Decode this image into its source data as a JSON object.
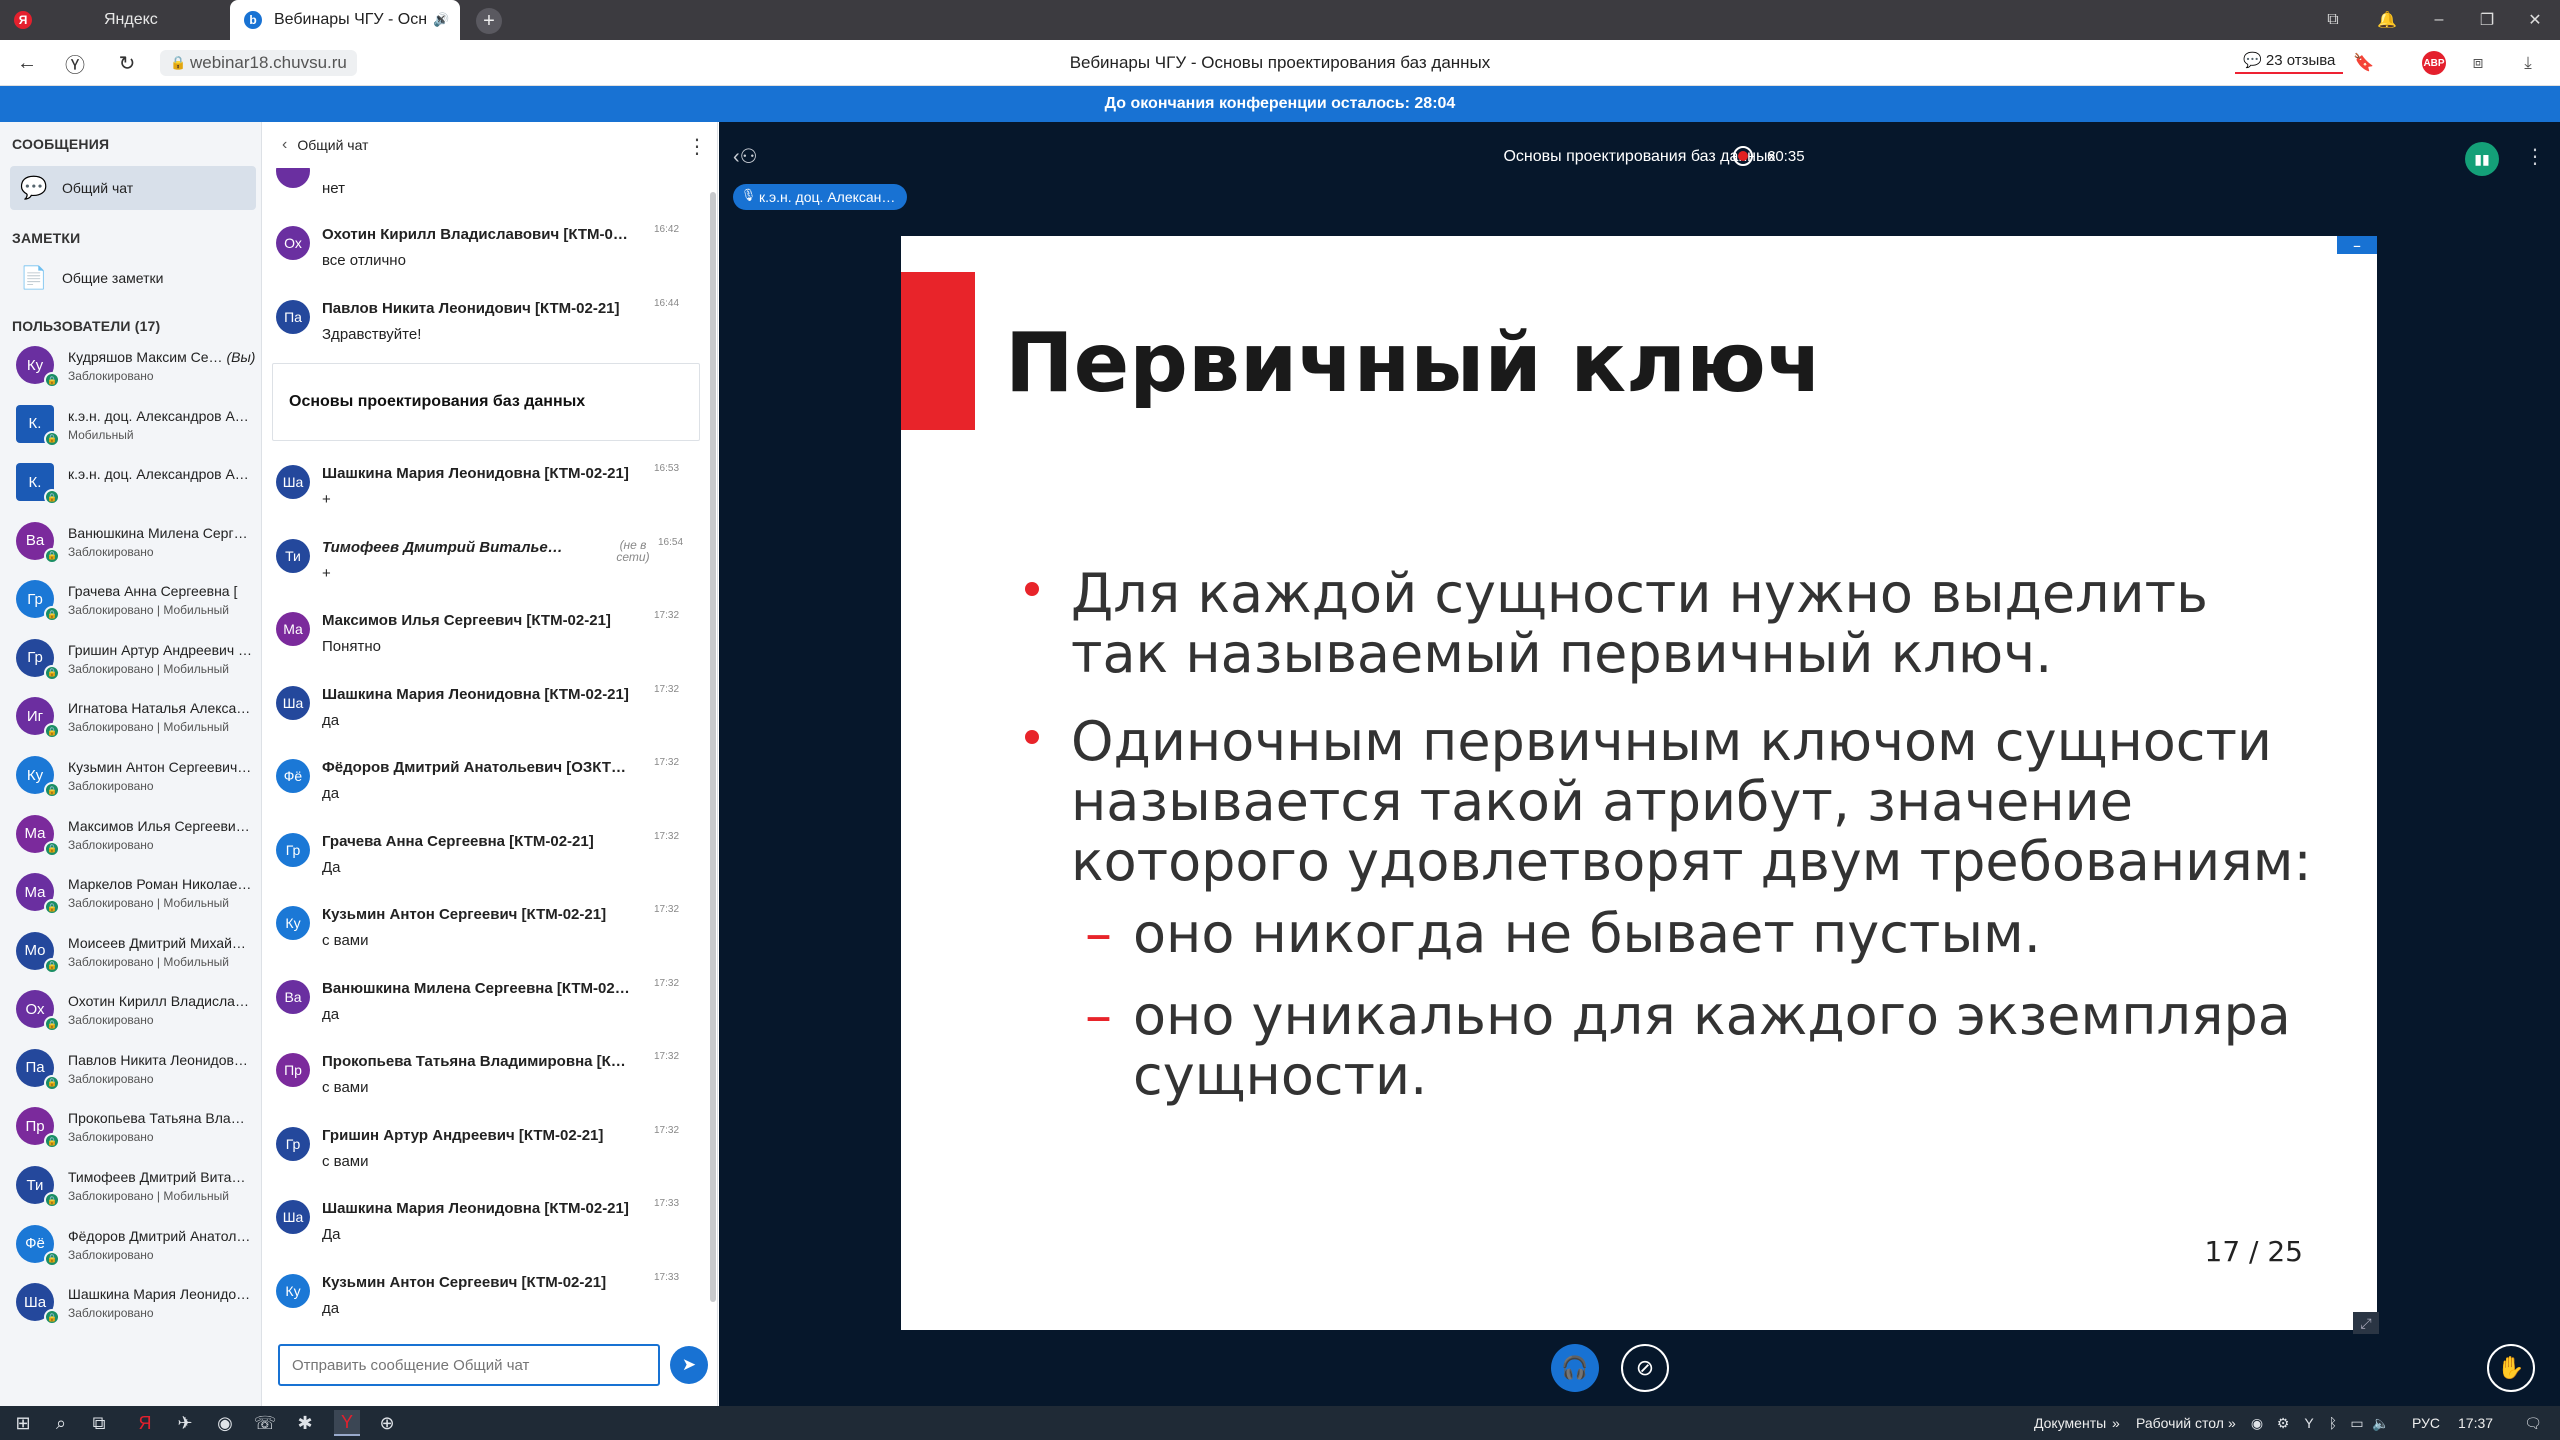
{
  "browser": {
    "tabs": [
      {
        "label": "Яндекс",
        "favicon": "Я",
        "favicon_color": "#e4202d"
      },
      {
        "label": "Вебинары ЧГУ - Осн",
        "favicon": "b",
        "favicon_color": "#1872d3",
        "sound_icon": "speaker-icon",
        "close": "×"
      }
    ],
    "new_tab": "+",
    "url": "webinar18.chuvsu.ru",
    "page_title": "Вебинары ЧГУ - Основы проектирования баз данных",
    "reviews": "23 отзыва",
    "adblock": "ABP"
  },
  "banner": "До окончания конференции осталось: 28:04",
  "sidebar": {
    "messages_header": "СООБЩЕНИЯ",
    "general_chat": "Общий чат",
    "notes_header": "ЗАМЕТКИ",
    "shared_notes": "Общие заметки",
    "users_header": "ПОЛЬЗОВАТЕЛИ (17)",
    "users": [
      {
        "initials": "Ку",
        "name": "Кудряшов Максим Се…",
        "you": "(Вы)",
        "sub": "Заблокировано",
        "color": "#6a2fa0"
      },
      {
        "initials": "К.",
        "name": "к.э.н. доц. Александров А…",
        "sub": "Мобильный",
        "color": "#1b5ab5",
        "square": true
      },
      {
        "initials": "К.",
        "name": "к.э.н. доц. Александров А…",
        "sub": "",
        "color": "#1b5ab5",
        "square": true
      },
      {
        "initials": "Ва",
        "name": "Ванюшкина Милена Серг…",
        "sub": "Заблокировано",
        "color": "#7b2a9c"
      },
      {
        "initials": "Гр",
        "name": "Грачева Анна Сергеевна [",
        "sub": "Заблокировано | Мобильный",
        "color": "#1b78d6"
      },
      {
        "initials": "Гр",
        "name": "Гришин Артур Андреевич …",
        "sub": "Заблокировано | Мобильный",
        "color": "#24489c"
      },
      {
        "initials": "Иг",
        "name": "Игнатова Наталья Алекса…",
        "sub": "Заблокировано | Мобильный",
        "color": "#6c2ea0"
      },
      {
        "initials": "Ку",
        "name": "Кузьмин Антон Сергеевич…",
        "sub": "Заблокировано",
        "color": "#1b78d6"
      },
      {
        "initials": "Ма",
        "name": "Максимов Илья Сергееви…",
        "sub": "Заблокировано",
        "color": "#7b2a9c"
      },
      {
        "initials": "Ма",
        "name": "Маркелов Роман Николае…",
        "sub": "Заблокировано | Мобильный",
        "color": "#6a2fa0"
      },
      {
        "initials": "Мо",
        "name": "Моисеев Дмитрий Михай…",
        "sub": "Заблокировано | Мобильный",
        "color": "#24489c"
      },
      {
        "initials": "Ох",
        "name": "Охотин Кирилл Владисла…",
        "sub": "Заблокировано",
        "color": "#6a2fa0"
      },
      {
        "initials": "Па",
        "name": "Павлов Никита Леонидов…",
        "sub": "Заблокировано",
        "color": "#24489c"
      },
      {
        "initials": "Пр",
        "name": "Прокопьева Татьяна Вла…",
        "sub": "Заблокировано",
        "color": "#7b2a9c"
      },
      {
        "initials": "Ти",
        "name": "Тимофеев Дмитрий Вита…",
        "sub": "Заблокировано | Мобильный",
        "color": "#24489c"
      },
      {
        "initials": "Фё",
        "name": "Фёдоров Дмитрий Анатол…",
        "sub": "Заблокировано",
        "color": "#1b78d6"
      },
      {
        "initials": "Ша",
        "name": "Шашкина Мария Леонидо…",
        "sub": "Заблокировано",
        "color": "#24489c"
      }
    ]
  },
  "chat": {
    "header": "Общий чат",
    "first_text": "нет",
    "messages": [
      {
        "initials": "Ох",
        "name": "Охотин Кирилл Владиславович [КТМ-0…",
        "time": "16:42",
        "text": "все отлично",
        "color": "#6a2fa0"
      },
      {
        "initials": "Па",
        "name": "Павлов Никита Леонидович [КТМ-02-21]",
        "time": "16:44",
        "text": "Здравствуйте!",
        "color": "#24489c"
      },
      {
        "initials": "Ша",
        "name": "Шашкина Мария Леонидовна [КТМ-02-21]",
        "time": "16:53",
        "text": "+",
        "color": "#24489c"
      },
      {
        "initials": "Ти",
        "name": "Тимофеев Дмитрий Виталье…",
        "time": "16:54",
        "text": "+",
        "color": "#24489c",
        "offline": "(не в сети)"
      },
      {
        "initials": "Ма",
        "name": "Максимов Илья Сергеевич [КТМ-02-21]",
        "time": "17:32",
        "text": "Понятно",
        "color": "#7b2a9c"
      },
      {
        "initials": "Ша",
        "name": "Шашкина Мария Леонидовна [КТМ-02-21]",
        "time": "17:32",
        "text": "да",
        "color": "#24489c"
      },
      {
        "initials": "Фё",
        "name": "Фёдоров Дмитрий Анатольевич [ОЗКТ…",
        "time": "17:32",
        "text": "да",
        "color": "#1b78d6"
      },
      {
        "initials": "Гр",
        "name": "Грачева Анна Сергеевна [КТМ-02-21]",
        "time": "17:32",
        "text": "Да",
        "color": "#1b78d6"
      },
      {
        "initials": "Ку",
        "name": "Кузьмин Антон Сергеевич [КТМ-02-21]",
        "time": "17:32",
        "text": "с вами",
        "color": "#1b78d6"
      },
      {
        "initials": "Ва",
        "name": "Ванюшкина Милена Сергеевна [КТМ-02…",
        "time": "17:32",
        "text": "да",
        "color": "#6a2fa0"
      },
      {
        "initials": "Пр",
        "name": "Прокопьева Татьяна Владимировна [К…",
        "time": "17:32",
        "text": "с вами",
        "color": "#7b2a9c"
      },
      {
        "initials": "Гр",
        "name": "Гришин Артур Андреевич [КТМ-02-21]",
        "time": "17:32",
        "text": "с вами",
        "color": "#24489c"
      },
      {
        "initials": "Ша",
        "name": "Шашкина Мария Леонидовна [КТМ-02-21]",
        "time": "17:33",
        "text": "Да",
        "color": "#24489c"
      },
      {
        "initials": "Ку",
        "name": "Кузьмин Антон Сергеевич [КТМ-02-21]",
        "time": "17:33",
        "text": "да",
        "color": "#1b78d6"
      }
    ],
    "pinned": "Основы проектирования баз данных",
    "input_placeholder": "Отправить сообщение Общий чат"
  },
  "presentation": {
    "title": "Основы проектирования баз данных",
    "record_time": "60:35",
    "presenter": "к.э.н. доц. Алексан…",
    "slide": {
      "heading": "Первичный ключ",
      "bullet1_line1": "Для каждой сущности нужно выделить",
      "bullet1_line2": "так называемый первичный ключ.",
      "bullet2_line1": "Одиночным первичным ключом сущности",
      "bullet2_line2": "называется такой атрибут, значение",
      "bullet2_line3": "которого удовлетворят двум требованиям:",
      "sub1": "оно никогда не бывает пустым.",
      "sub2_line1": "оно уникально для каждого экземпляра",
      "sub2_line2": "сущности.",
      "page": "17 / 25",
      "dash": "–"
    }
  },
  "taskbar": {
    "documents": "Документы",
    "desktop": "Рабочий стол",
    "lang": "РУС",
    "time": "17:37",
    "chevron": "»"
  }
}
